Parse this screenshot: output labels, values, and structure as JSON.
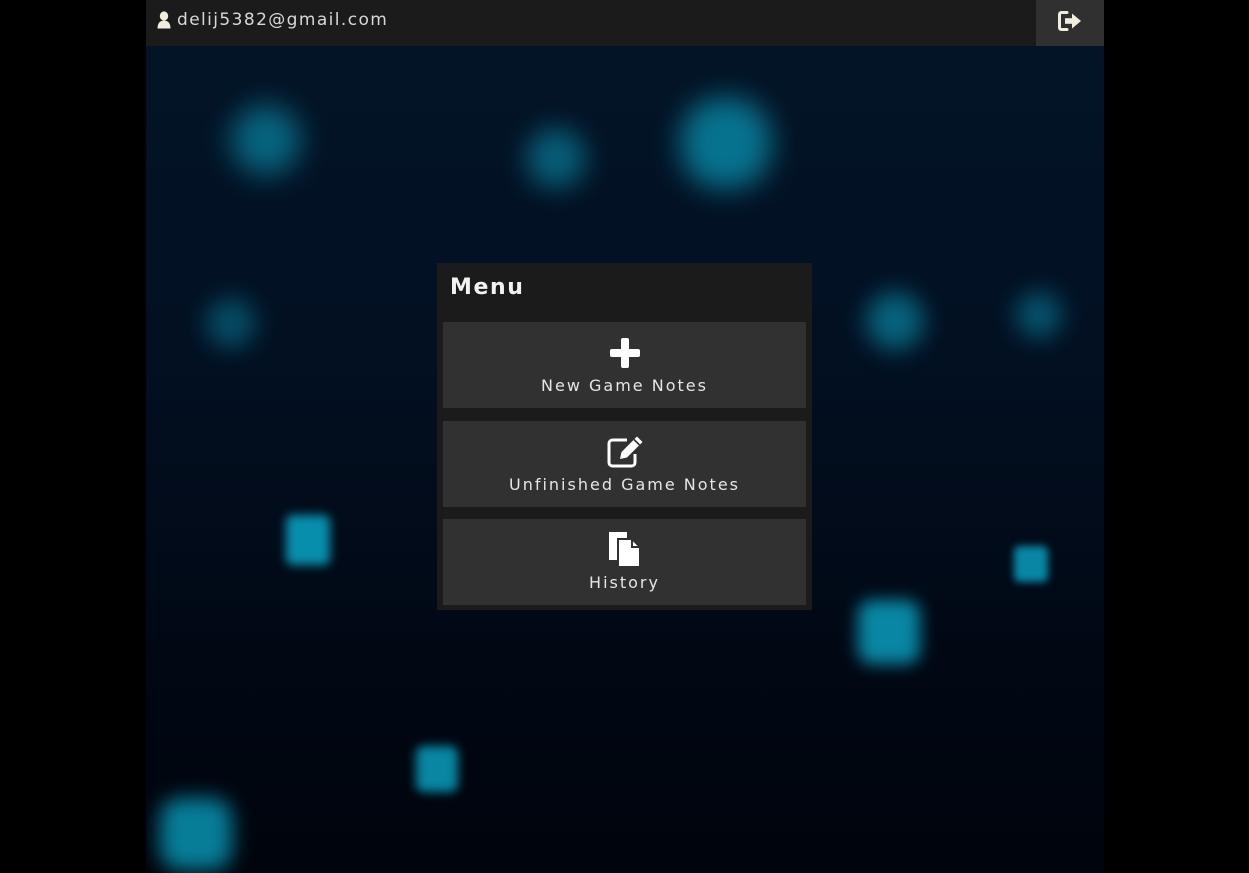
{
  "header": {
    "user_email": "delij5382@gmail.com",
    "user_icon": "user-icon",
    "logout_icon": "sign-out-icon"
  },
  "menu": {
    "title": "Menu",
    "items": [
      {
        "label": "New Game Notes",
        "icon": "plus-icon"
      },
      {
        "label": "Unfinished Game Notes",
        "icon": "edit-icon"
      },
      {
        "label": "History",
        "icon": "files-icon"
      }
    ]
  },
  "colors": {
    "page_bg": "#000000",
    "panel_bg": "#1b1b1b",
    "button_bg": "#313131",
    "text": "#e6e6e6",
    "accent_glow": "#0aa6c7"
  }
}
